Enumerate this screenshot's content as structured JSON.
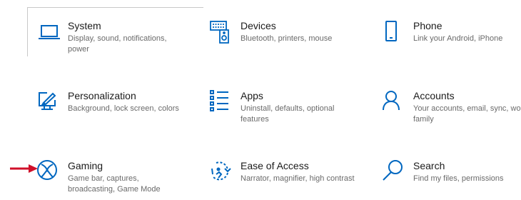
{
  "accent_color": "#0067c0",
  "arrow_color": "#d0102a",
  "tiles": [
    {
      "title": "System",
      "desc": "Display, sound, notifications, power",
      "icon": "laptop-icon"
    },
    {
      "title": "Devices",
      "desc": "Bluetooth, printers, mouse",
      "icon": "devices-icon"
    },
    {
      "title": "Phone",
      "desc": "Link your Android, iPhone",
      "icon": "phone-icon"
    },
    {
      "title": "Personalization",
      "desc": "Background, lock screen, colors",
      "icon": "personalization-icon"
    },
    {
      "title": "Apps",
      "desc": "Uninstall, defaults, optional features",
      "icon": "apps-icon"
    },
    {
      "title": "Accounts",
      "desc": "Your accounts, email, sync, work, family",
      "icon": "person-icon"
    },
    {
      "title": "Gaming",
      "desc": "Game bar, captures, broadcasting, Game Mode",
      "icon": "xbox-icon"
    },
    {
      "title": "Ease of Access",
      "desc": "Narrator, magnifier, high contrast",
      "icon": "ease-of-access-icon"
    },
    {
      "title": "Search",
      "desc": "Find my files, permissions",
      "icon": "search-icon"
    }
  ]
}
